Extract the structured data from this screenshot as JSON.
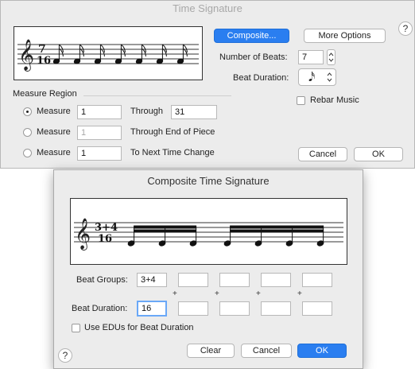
{
  "time_signature_window": {
    "title": "Time Signature",
    "composite_button": "Composite...",
    "more_options_button": "More Options",
    "help_label": "?",
    "number_of_beats_label": "Number of Beats:",
    "number_of_beats_value": "7",
    "beat_duration_label": "Beat Duration:",
    "beat_duration_glyph": "𝅘𝅥𝅯",
    "preview_time_signature": {
      "top": "7",
      "bottom": "16"
    },
    "rebar_music_label": "Rebar Music",
    "rebar_music_checked": false,
    "measure_region_label": "Measure Region",
    "rows": [
      {
        "radio_label": "Measure",
        "selected": true,
        "from_value": "1",
        "from_disabled": false,
        "suffix": "Through",
        "to_value": "31"
      },
      {
        "radio_label": "Measure",
        "selected": false,
        "from_value": "1",
        "from_disabled": true,
        "suffix": "Through End of Piece"
      },
      {
        "radio_label": "Measure",
        "selected": false,
        "from_value": "1",
        "from_disabled": false,
        "suffix": "To Next Time Change"
      }
    ],
    "cancel_button": "Cancel",
    "ok_button": "OK"
  },
  "composite_window": {
    "title": "Composite Time Signature",
    "preview_time_signature": {
      "top": "3+4",
      "bottom": "16"
    },
    "beat_groups_label": "Beat Groups:",
    "beat_groups": [
      "3+4",
      "",
      "",
      "",
      ""
    ],
    "beat_duration_label": "Beat Duration:",
    "beat_durations": [
      "16",
      "",
      "",
      "",
      ""
    ],
    "plus_sign": "+",
    "use_edus_label": "Use EDUs for Beat Duration",
    "use_edus_checked": false,
    "help_label": "?",
    "clear_button": "Clear",
    "cancel_button": "Cancel",
    "ok_button": "OK"
  },
  "colors": {
    "accent": "#2a7ef0",
    "window_bg": "#ececec",
    "border": "#b8b8b8"
  }
}
